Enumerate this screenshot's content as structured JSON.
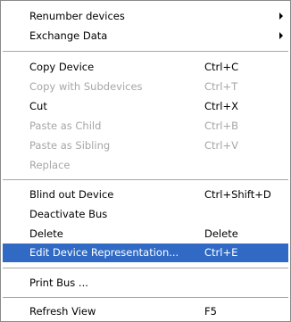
{
  "menu": {
    "items": [
      {
        "label": "Renumber devices",
        "shortcut": "",
        "submenu": true,
        "enabled": true
      },
      {
        "label": "Exchange Data",
        "shortcut": "",
        "submenu": true,
        "enabled": true
      },
      {
        "label": "Copy Device",
        "shortcut": "Ctrl+C",
        "enabled": true
      },
      {
        "label": "Copy with Subdevices",
        "shortcut": "Ctrl+T",
        "enabled": false
      },
      {
        "label": "Cut",
        "shortcut": "Ctrl+X",
        "enabled": true
      },
      {
        "label": "Paste as Child",
        "shortcut": "Ctrl+B",
        "enabled": false
      },
      {
        "label": "Paste as Sibling",
        "shortcut": "Ctrl+V",
        "enabled": false
      },
      {
        "label": "Replace",
        "shortcut": "",
        "enabled": false
      },
      {
        "label": "Blind out Device",
        "shortcut": "Ctrl+Shift+D",
        "enabled": true
      },
      {
        "label": "Deactivate Bus",
        "shortcut": "",
        "enabled": true
      },
      {
        "label": "Delete",
        "shortcut": "Delete",
        "enabled": true
      },
      {
        "label": "Edit Device Representation...",
        "shortcut": "Ctrl+E",
        "enabled": true,
        "selected": true
      },
      {
        "label": "Print Bus ...",
        "shortcut": "",
        "enabled": true
      },
      {
        "label": "Refresh View",
        "shortcut": "F5",
        "enabled": true
      }
    ],
    "colors": {
      "highlight": "#316ac5",
      "disabled_text": "#a6a6a6",
      "separator": "#a6a6a6"
    }
  }
}
